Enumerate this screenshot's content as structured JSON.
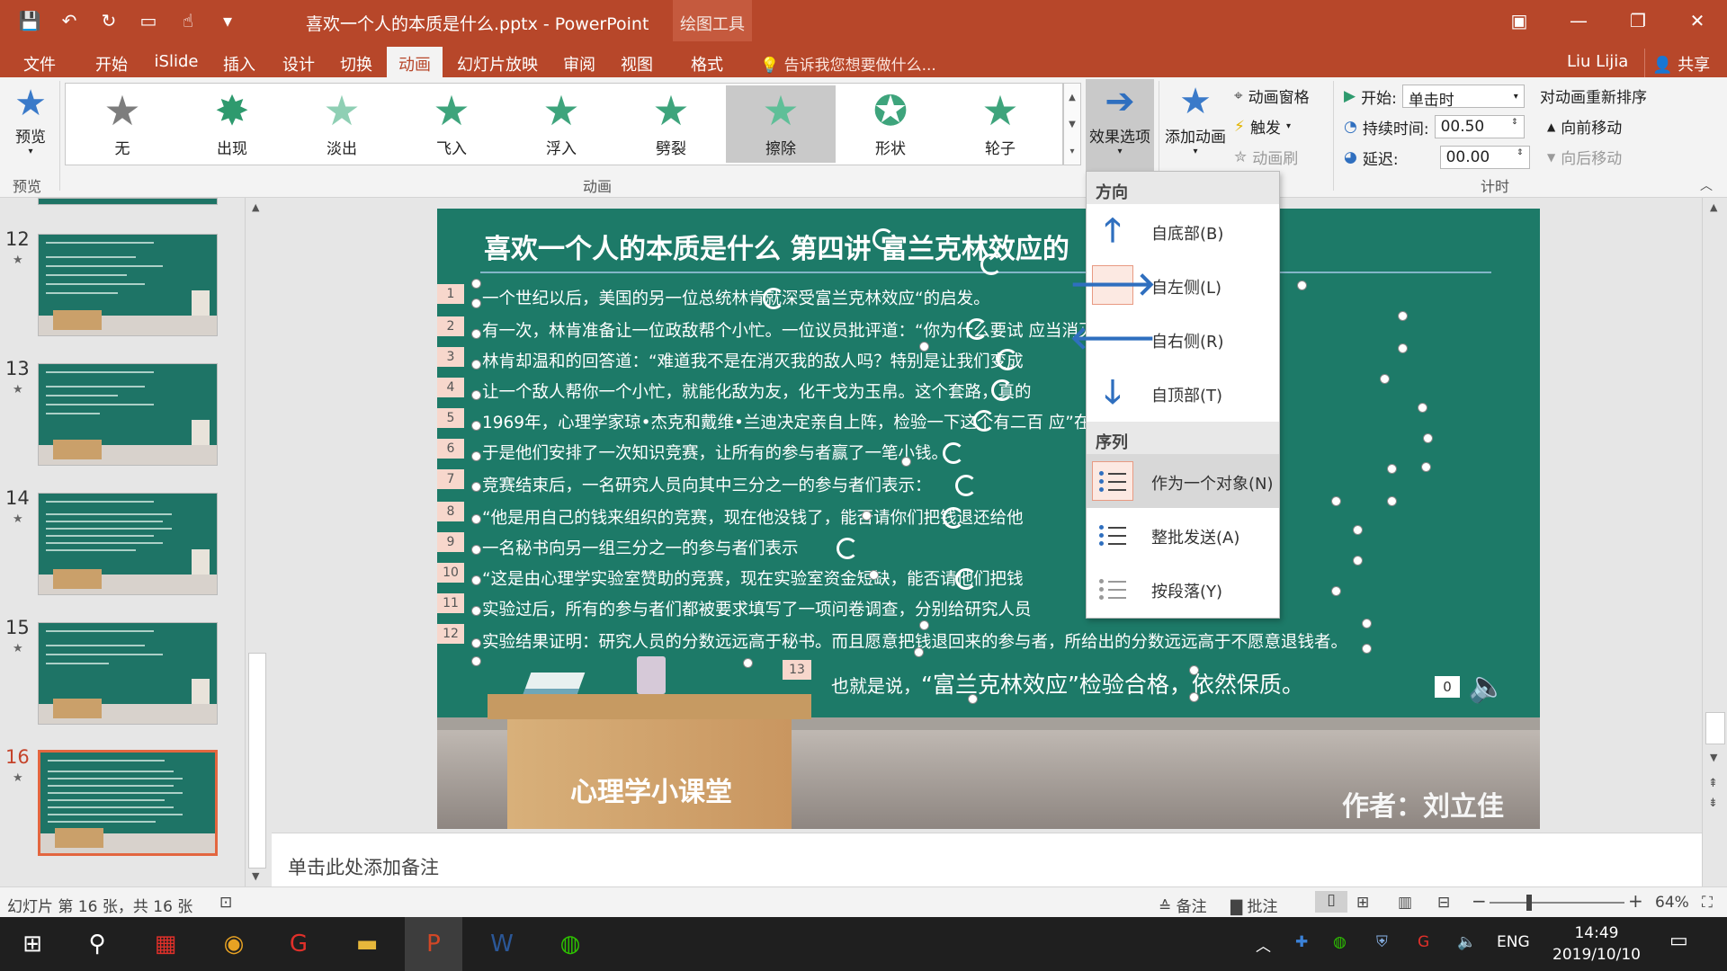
{
  "titlebar": {
    "title": "喜欢一个人的本质是什么.pptx - PowerPoint",
    "context_tools": "绘图工具",
    "minimize": "—",
    "restore": "❐",
    "close": "✕",
    "ribbon_display": "▣"
  },
  "tabs": {
    "file": "文件",
    "home": "开始",
    "islide": "iSlide",
    "insert": "插入",
    "design": "设计",
    "transitions": "切换",
    "animations": "动画",
    "slideshow": "幻灯片放映",
    "review": "审阅",
    "view": "视图",
    "format": "格式",
    "tellme": "告诉我您想要做什么...",
    "user": "Liu Lijia",
    "share": "共享"
  },
  "ribbon": {
    "preview": "预览",
    "preview_group": "预览",
    "animation_group": "动画",
    "timing_group": "计时",
    "gallery": [
      "无",
      "出现",
      "淡出",
      "飞入",
      "浮入",
      "劈裂",
      "擦除",
      "形状",
      "轮子"
    ],
    "effect_options": "效果选项",
    "add_animation": "添加动画",
    "animation_pane": "动画窗格",
    "trigger": "触发",
    "animation_painter": "动画刷",
    "start_label": "开始:",
    "start_value": "单击时",
    "duration_label": "持续时间:",
    "duration_value": "00.50",
    "delay_label": "延迟:",
    "delay_value": "00.00",
    "reorder": "对动画重新排序",
    "move_earlier": "向前移动",
    "move_later": "向后移动"
  },
  "thumbnails": [
    {
      "num": "12"
    },
    {
      "num": "13"
    },
    {
      "num": "14"
    },
    {
      "num": "15"
    },
    {
      "num": "16"
    }
  ],
  "slide": {
    "title": "喜欢一个人的本质是什么 第四讲 富兰克林效应的",
    "lines": [
      {
        "n": "1",
        "text": "一个世纪以后，美国的另一位总统林肯就深受富兰克林效应“的启发。"
      },
      {
        "n": "2",
        "text": "有一次，林肯准备让一位政敌帮个小忙。一位议员批评道：“你为什么要试                          应当消灭他们。”"
      },
      {
        "n": "3",
        "text": "林肯却温和的回答道：“难道我不是在消灭我的敌人吗？特别是让我们变成"
      },
      {
        "n": "4",
        "text": "让一个敌人帮你一个小忙，就能化敌为友，化干戈为玉帛。这个套路，真的"
      },
      {
        "n": "5",
        "text": "1969年，心理学家琼•杰克和戴维•兰迪决定亲自上阵，检验一下这个有二百                      应”在20世纪是否已经过期。"
      },
      {
        "n": "6",
        "text": "于是他们安排了一次知识竞赛，让所有的参与者赢了一笔小钱。"
      },
      {
        "n": "7",
        "text": "竞赛结束后，一名研究人员向其中三分之一的参与者们表示："
      },
      {
        "n": "8",
        "text": "“他是用自己的钱来组织的竞赛，现在他没钱了，能否请你们把钱退还给他"
      },
      {
        "n": "9",
        "text": "一名秘书向另一组三分之一的参与者们表示"
      },
      {
        "n": "10",
        "text": "“这是由心理学实验室赞助的竞赛，现在实验室资金短缺，能否请他们把钱"
      },
      {
        "n": "11",
        "text": "实验过后，所有的参与者们都被要求填写了一项问卷调查，分别给研究人员"
      },
      {
        "n": "12",
        "text": "实验结果证明：研究人员的分数远远高于秘书。而且愿意把钱退回来的参与者，所给出的分数远远高于不愿意退钱者。"
      }
    ],
    "line13_num": "13",
    "line13_a": "也就是说，",
    "line13_b": "“富兰克林效应”检验合格，依然保质。",
    "desk_text": "心理学小课堂",
    "author": "作者：刘立佳",
    "audio_badge": "0"
  },
  "dropdown": {
    "direction_header": "方向",
    "directions": [
      "自底部(B)",
      "自左侧(L)",
      "自右侧(R)",
      "自顶部(T)"
    ],
    "sequence_header": "序列",
    "sequences": [
      "作为一个对象(N)",
      "整批发送(A)",
      "按段落(Y)"
    ]
  },
  "notes": {
    "placeholder": "单击此处添加备注"
  },
  "status": {
    "slide_info": "幻灯片 第 16 张，共 16 张",
    "notes_btn": "备注",
    "comments_btn": "批注",
    "zoom": "64%"
  },
  "taskbar": {
    "lang": "ENG",
    "time": "14:49",
    "date": "2019/10/10"
  },
  "colors": {
    "ppt_accent": "#b7472a",
    "slide_green": "#1d7a68",
    "selected_thumb_border": "#e3663f"
  }
}
